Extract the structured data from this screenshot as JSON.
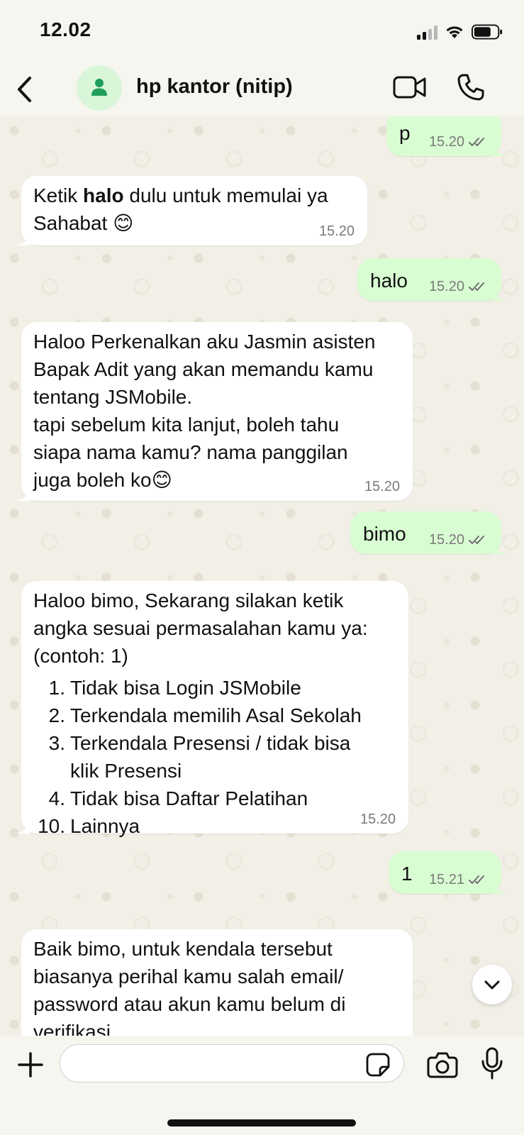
{
  "status_bar": {
    "time": "12.02"
  },
  "header": {
    "contact_name": "hp kantor (nitip)",
    "icons": [
      "back-icon",
      "person-icon",
      "video-call-icon",
      "phone-call-icon"
    ]
  },
  "messages": [
    {
      "id": "m1",
      "direction": "out",
      "text": "p",
      "time": "15.20",
      "read": true
    },
    {
      "id": "m2",
      "direction": "in",
      "text_before": "Ketik ",
      "text_bold": "halo",
      "text_after": " dulu untuk memulai ya\nSahabat 😊",
      "time": "15.20"
    },
    {
      "id": "m3",
      "direction": "out",
      "text": "halo",
      "time": "15.20",
      "read": true
    },
    {
      "id": "m4",
      "direction": "in",
      "text": "Haloo Perkenalkan aku Jasmin asisten\nBapak Adit yang akan memandu kamu\ntentang JSMobile.\ntapi sebelum kita lanjut, boleh tahu\nsiapa nama kamu? nama panggilan\njuga boleh ko😊",
      "time": "15.20"
    },
    {
      "id": "m5",
      "direction": "out",
      "text": "bimo",
      "time": "15.20",
      "read": true
    },
    {
      "id": "m6",
      "direction": "in",
      "text": "Haloo bimo, Sekarang silakan ketik\nangka sesuai permasalahan kamu ya:\n(contoh: 1)",
      "list": [
        {
          "num": "1.",
          "text": "Tidak bisa Login JSMobile"
        },
        {
          "num": "2.",
          "text": "Terkendala memilih Asal Sekolah"
        },
        {
          "num": "3.",
          "text": "Terkendala Presensi / tidak bisa\nklik Presensi"
        },
        {
          "num": "4.",
          "text": "Tidak bisa Daftar Pelatihan"
        },
        {
          "num": "10.",
          "text": "Lainnya"
        }
      ],
      "time": "15.20"
    },
    {
      "id": "m7",
      "direction": "out",
      "text": "1",
      "time": "15.21",
      "read": true
    },
    {
      "id": "m8",
      "direction": "in",
      "text": "Baik bimo, untuk kendala tersebut\nbiasanya perihal kamu salah email/\npassword atau akun kamu belum di\nverifikasi"
    }
  ],
  "composer": {
    "input_value": "",
    "icons": [
      "plus-icon",
      "sticker-icon",
      "camera-icon",
      "microphone-icon"
    ]
  },
  "colors": {
    "outgoing_bubble": "#d9fdd3",
    "incoming_bubble": "#ffffff",
    "read_ticks": "#7a7a7a",
    "avatar_bg": "#d9f6d8",
    "avatar_fg": "#1e9e5a"
  }
}
